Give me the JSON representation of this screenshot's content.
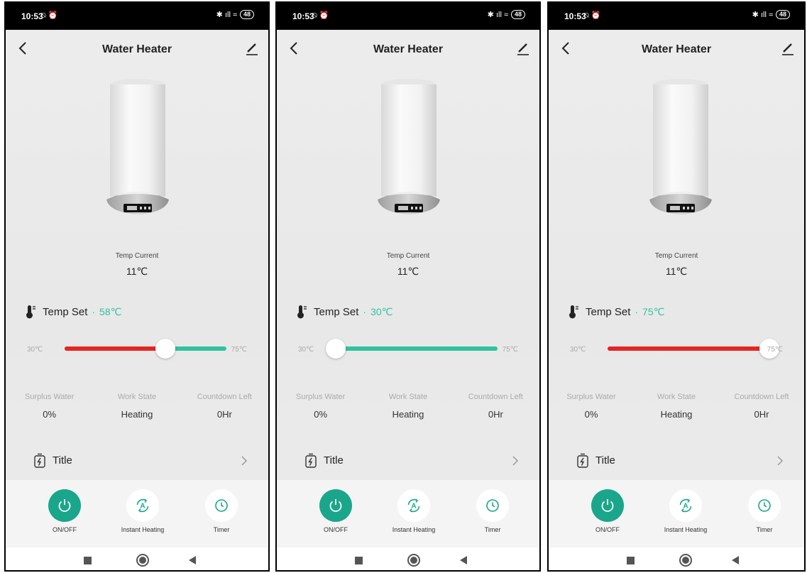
{
  "accent_color": "#2fc39f",
  "heat_color": "#e52521",
  "power_on_color": "#1aa68a",
  "screens": [
    {
      "status": {
        "time": "10:53",
        "icons": "⍉ ⏰",
        "signal": "✱ ıll ≈",
        "battery": "48"
      },
      "title": "Water Heater",
      "temp_current_label": "Temp Current",
      "temp_current_value": "11℃",
      "tempset_label": "Temp Set",
      "tempset_dot": "·",
      "tempset_value": "58℃",
      "slider": {
        "min_label": "30℃",
        "max_label": "75℃",
        "min": 30,
        "max": 75,
        "value": 58
      },
      "stats": [
        {
          "label": "Surplus Water",
          "value": "0%"
        },
        {
          "label": "Work State",
          "value": "Heating"
        },
        {
          "label": "Countdown Left",
          "value": "0Hr"
        }
      ],
      "row_title": "Title",
      "actions": [
        {
          "label": "ON/OFF",
          "icon": "power-icon"
        },
        {
          "label": "Instant Heating",
          "icon": "instant-heating-icon"
        },
        {
          "label": "Timer",
          "icon": "clock-icon"
        }
      ]
    },
    {
      "status": {
        "time": "10:53",
        "icons": "⍉ ⏰",
        "signal": "✱ ıll ≈",
        "battery": "48"
      },
      "title": "Water Heater",
      "temp_current_label": "Temp Current",
      "temp_current_value": "11℃",
      "tempset_label": "Temp Set",
      "tempset_dot": "·",
      "tempset_value": "30℃",
      "slider": {
        "min_label": "30℃",
        "max_label": "75℃",
        "min": 30,
        "max": 75,
        "value": 30
      },
      "stats": [
        {
          "label": "Surplus Water",
          "value": "0%"
        },
        {
          "label": "Work State",
          "value": "Heating"
        },
        {
          "label": "Countdown Left",
          "value": "0Hr"
        }
      ],
      "row_title": "Title",
      "actions": [
        {
          "label": "ON/OFF",
          "icon": "power-icon"
        },
        {
          "label": "Instant Heating",
          "icon": "instant-heating-icon"
        },
        {
          "label": "Timer",
          "icon": "clock-icon"
        }
      ]
    },
    {
      "status": {
        "time": "10:53",
        "icons": "⍉ ⏰",
        "signal": "✱ ıll ≈",
        "battery": "48"
      },
      "title": "Water Heater",
      "temp_current_label": "Temp Current",
      "temp_current_value": "11℃",
      "tempset_label": "Temp Set",
      "tempset_dot": "·",
      "tempset_value": "75℃",
      "slider": {
        "min_label": "30℃",
        "max_label": "75℃",
        "min": 30,
        "max": 75,
        "value": 75
      },
      "stats": [
        {
          "label": "Surplus Water",
          "value": "0%"
        },
        {
          "label": "Work State",
          "value": "Heating"
        },
        {
          "label": "Countdown Left",
          "value": "0Hr"
        }
      ],
      "row_title": "Title",
      "actions": [
        {
          "label": "ON/OFF",
          "icon": "power-icon"
        },
        {
          "label": "Instant Heating",
          "icon": "instant-heating-icon"
        },
        {
          "label": "Timer",
          "icon": "clock-icon"
        }
      ]
    }
  ]
}
